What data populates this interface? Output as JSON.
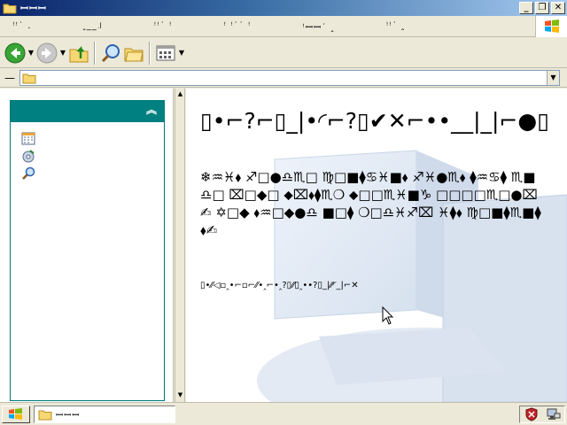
{
  "window": {
    "title": "ꟷꟷꟷ"
  },
  "menubar": {
    "items": [
      {
        "label": "ꜝꜝ˙ ."
      },
      {
        "label": "ꞈ__꜌"
      },
      {
        "label": "ꜝꜝ˙ ꜝ"
      },
      {
        "label": "ꜝ ꜝ˙˙ ꜝ"
      },
      {
        "label": "ꜝꟷꟷ˙ ꞈ"
      },
      {
        "label": "ꜝꜝ˙ ꞈ"
      }
    ]
  },
  "address": {
    "value": ""
  },
  "welcome": {
    "title": "▯•⌐?⌐▯_|•◜⌐?▯✔✕⌐••__|_|⌐●▯",
    "body": "❄♒♓⬧ ♐□●♎♏□ ♍□■⧫♋♓■⬧ ♐♓●♏⬧ ⧫♒♋⧫ ♏■♎□ ⌧□◆□ ⬥⌧⬧⧫♏❍ ⬥□□♏♓■♑ □□□□♏□●⌧✍ ✡□◆ ⬧♒□◆●♎ ■□⧫ ❍□♎♓♐⌧ ♓⧫⬧ ♍□■⧫♏■⧫⬧✍",
    "link": "▯•⁄⁄◁▫‸•⌐▫⌐⁄⁄•‸⌐•‸?▯⁄⁄▯‸••?▯_|⁄⁄◜_|⌐✕"
  },
  "colors": {
    "titlebar": "#0a246a",
    "taskbox_header": "#008080",
    "background": "#ece9d8"
  }
}
